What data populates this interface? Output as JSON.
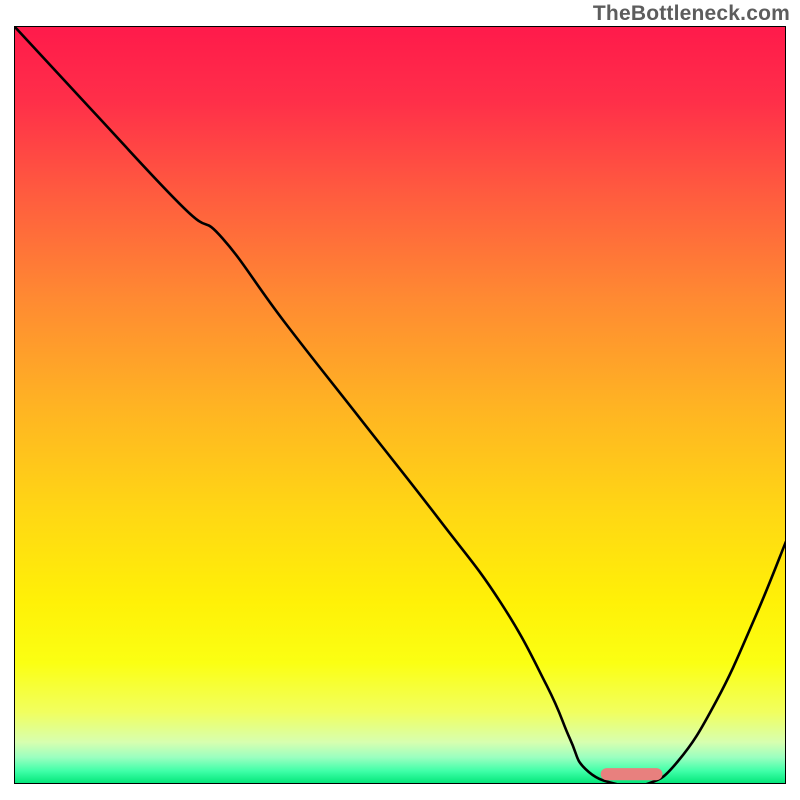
{
  "watermark": "TheBottleneck.com",
  "chart_data": {
    "type": "line",
    "title": "",
    "xlabel": "",
    "ylabel": "",
    "xlim": [
      0,
      100
    ],
    "ylim": [
      0,
      100
    ],
    "gradient_stops": [
      {
        "offset": 0.0,
        "color": "#ff1a4b"
      },
      {
        "offset": 0.1,
        "color": "#ff2f49"
      },
      {
        "offset": 0.22,
        "color": "#ff5b3f"
      },
      {
        "offset": 0.36,
        "color": "#ff8a32"
      },
      {
        "offset": 0.5,
        "color": "#ffb323"
      },
      {
        "offset": 0.64,
        "color": "#ffd714"
      },
      {
        "offset": 0.76,
        "color": "#fff107"
      },
      {
        "offset": 0.84,
        "color": "#fbff13"
      },
      {
        "offset": 0.905,
        "color": "#f1ff5f"
      },
      {
        "offset": 0.945,
        "color": "#d7ffb0"
      },
      {
        "offset": 0.965,
        "color": "#9affc0"
      },
      {
        "offset": 0.983,
        "color": "#3fffa8"
      },
      {
        "offset": 1.0,
        "color": "#00e477"
      }
    ],
    "series": [
      {
        "name": "bottleneck-curve",
        "x": [
          0,
          10,
          22,
          27,
          35,
          45,
          55,
          63,
          69,
          72,
          74,
          78,
          82,
          86,
          91,
          96,
          100
        ],
        "values": [
          100,
          89,
          76,
          72,
          61,
          48,
          35,
          24,
          13,
          6,
          2,
          0,
          0,
          3,
          11,
          22,
          32
        ]
      }
    ],
    "marker": {
      "x_start": 76,
      "x_end": 84,
      "y": 1.3,
      "height_pct": 1.6,
      "color": "#e8807e"
    }
  }
}
